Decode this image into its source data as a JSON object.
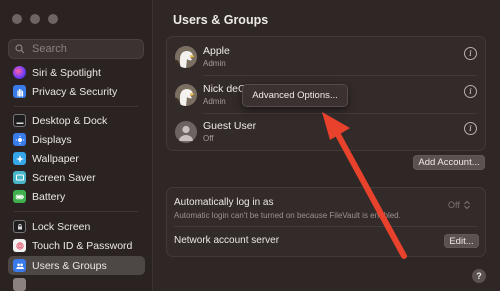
{
  "sidebar": {
    "search_placeholder": "Search",
    "items": [
      {
        "label": "Siri & Spotlight",
        "icon": "siri-icon"
      },
      {
        "label": "Privacy & Security",
        "icon": "hand-icon"
      },
      {
        "label": "Desktop & Dock",
        "icon": "dock-icon"
      },
      {
        "label": "Displays",
        "icon": "sun-icon"
      },
      {
        "label": "Wallpaper",
        "icon": "wallpaper-icon"
      },
      {
        "label": "Screen Saver",
        "icon": "screen-saver-icon"
      },
      {
        "label": "Battery",
        "icon": "battery-icon"
      },
      {
        "label": "Lock Screen",
        "icon": "lock-screen-icon"
      },
      {
        "label": "Touch ID & Password",
        "icon": "fingerprint-icon"
      },
      {
        "label": "Users & Groups",
        "icon": "users-icon"
      }
    ]
  },
  "main": {
    "title": "Users & Groups",
    "users": [
      {
        "name": "Apple",
        "role": "Admin"
      },
      {
        "name": "Nick deCo",
        "role": "Admin"
      },
      {
        "name": "Guest User",
        "role": "Off"
      }
    ],
    "context_menu_item": "Advanced Options...",
    "add_account_label": "Add Account...",
    "auto_login": {
      "label": "Automatically log in as",
      "note": "Automatic login can't be turned on because FileVault is enabled.",
      "value": "Off"
    },
    "network_server": {
      "label": "Network account server",
      "button": "Edit..."
    },
    "help_label": "?"
  },
  "colors": {
    "arrow": "#e8412c",
    "selected_sidebar": "#4d4746"
  }
}
